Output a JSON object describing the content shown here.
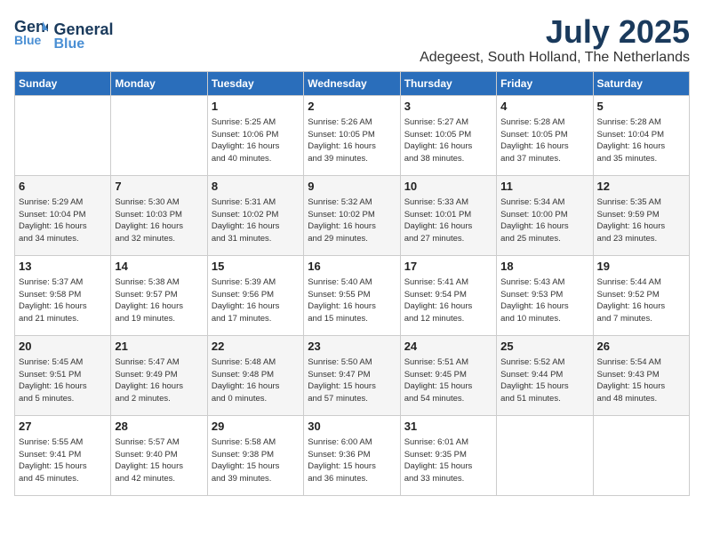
{
  "header": {
    "logo_general": "General",
    "logo_blue": "Blue",
    "month": "July 2025",
    "location": "Adegeest, South Holland, The Netherlands"
  },
  "days_of_week": [
    "Sunday",
    "Monday",
    "Tuesday",
    "Wednesday",
    "Thursday",
    "Friday",
    "Saturday"
  ],
  "weeks": [
    [
      {
        "day": "",
        "content": ""
      },
      {
        "day": "",
        "content": ""
      },
      {
        "day": "1",
        "content": "Sunrise: 5:25 AM\nSunset: 10:06 PM\nDaylight: 16 hours\nand 40 minutes."
      },
      {
        "day": "2",
        "content": "Sunrise: 5:26 AM\nSunset: 10:05 PM\nDaylight: 16 hours\nand 39 minutes."
      },
      {
        "day": "3",
        "content": "Sunrise: 5:27 AM\nSunset: 10:05 PM\nDaylight: 16 hours\nand 38 minutes."
      },
      {
        "day": "4",
        "content": "Sunrise: 5:28 AM\nSunset: 10:05 PM\nDaylight: 16 hours\nand 37 minutes."
      },
      {
        "day": "5",
        "content": "Sunrise: 5:28 AM\nSunset: 10:04 PM\nDaylight: 16 hours\nand 35 minutes."
      }
    ],
    [
      {
        "day": "6",
        "content": "Sunrise: 5:29 AM\nSunset: 10:04 PM\nDaylight: 16 hours\nand 34 minutes."
      },
      {
        "day": "7",
        "content": "Sunrise: 5:30 AM\nSunset: 10:03 PM\nDaylight: 16 hours\nand 32 minutes."
      },
      {
        "day": "8",
        "content": "Sunrise: 5:31 AM\nSunset: 10:02 PM\nDaylight: 16 hours\nand 31 minutes."
      },
      {
        "day": "9",
        "content": "Sunrise: 5:32 AM\nSunset: 10:02 PM\nDaylight: 16 hours\nand 29 minutes."
      },
      {
        "day": "10",
        "content": "Sunrise: 5:33 AM\nSunset: 10:01 PM\nDaylight: 16 hours\nand 27 minutes."
      },
      {
        "day": "11",
        "content": "Sunrise: 5:34 AM\nSunset: 10:00 PM\nDaylight: 16 hours\nand 25 minutes."
      },
      {
        "day": "12",
        "content": "Sunrise: 5:35 AM\nSunset: 9:59 PM\nDaylight: 16 hours\nand 23 minutes."
      }
    ],
    [
      {
        "day": "13",
        "content": "Sunrise: 5:37 AM\nSunset: 9:58 PM\nDaylight: 16 hours\nand 21 minutes."
      },
      {
        "day": "14",
        "content": "Sunrise: 5:38 AM\nSunset: 9:57 PM\nDaylight: 16 hours\nand 19 minutes."
      },
      {
        "day": "15",
        "content": "Sunrise: 5:39 AM\nSunset: 9:56 PM\nDaylight: 16 hours\nand 17 minutes."
      },
      {
        "day": "16",
        "content": "Sunrise: 5:40 AM\nSunset: 9:55 PM\nDaylight: 16 hours\nand 15 minutes."
      },
      {
        "day": "17",
        "content": "Sunrise: 5:41 AM\nSunset: 9:54 PM\nDaylight: 16 hours\nand 12 minutes."
      },
      {
        "day": "18",
        "content": "Sunrise: 5:43 AM\nSunset: 9:53 PM\nDaylight: 16 hours\nand 10 minutes."
      },
      {
        "day": "19",
        "content": "Sunrise: 5:44 AM\nSunset: 9:52 PM\nDaylight: 16 hours\nand 7 minutes."
      }
    ],
    [
      {
        "day": "20",
        "content": "Sunrise: 5:45 AM\nSunset: 9:51 PM\nDaylight: 16 hours\nand 5 minutes."
      },
      {
        "day": "21",
        "content": "Sunrise: 5:47 AM\nSunset: 9:49 PM\nDaylight: 16 hours\nand 2 minutes."
      },
      {
        "day": "22",
        "content": "Sunrise: 5:48 AM\nSunset: 9:48 PM\nDaylight: 16 hours\nand 0 minutes."
      },
      {
        "day": "23",
        "content": "Sunrise: 5:50 AM\nSunset: 9:47 PM\nDaylight: 15 hours\nand 57 minutes."
      },
      {
        "day": "24",
        "content": "Sunrise: 5:51 AM\nSunset: 9:45 PM\nDaylight: 15 hours\nand 54 minutes."
      },
      {
        "day": "25",
        "content": "Sunrise: 5:52 AM\nSunset: 9:44 PM\nDaylight: 15 hours\nand 51 minutes."
      },
      {
        "day": "26",
        "content": "Sunrise: 5:54 AM\nSunset: 9:43 PM\nDaylight: 15 hours\nand 48 minutes."
      }
    ],
    [
      {
        "day": "27",
        "content": "Sunrise: 5:55 AM\nSunset: 9:41 PM\nDaylight: 15 hours\nand 45 minutes."
      },
      {
        "day": "28",
        "content": "Sunrise: 5:57 AM\nSunset: 9:40 PM\nDaylight: 15 hours\nand 42 minutes."
      },
      {
        "day": "29",
        "content": "Sunrise: 5:58 AM\nSunset: 9:38 PM\nDaylight: 15 hours\nand 39 minutes."
      },
      {
        "day": "30",
        "content": "Sunrise: 6:00 AM\nSunset: 9:36 PM\nDaylight: 15 hours\nand 36 minutes."
      },
      {
        "day": "31",
        "content": "Sunrise: 6:01 AM\nSunset: 9:35 PM\nDaylight: 15 hours\nand 33 minutes."
      },
      {
        "day": "",
        "content": ""
      },
      {
        "day": "",
        "content": ""
      }
    ]
  ]
}
